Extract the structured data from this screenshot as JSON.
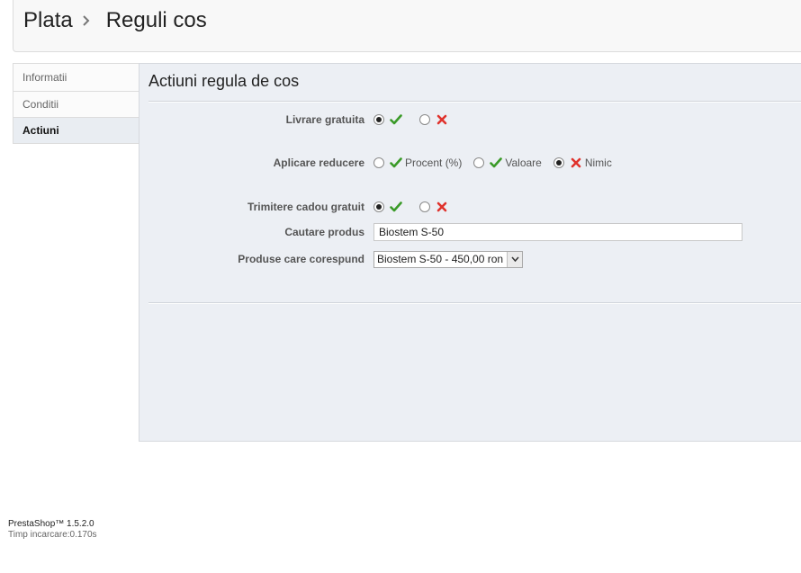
{
  "breadcrumb": {
    "parent": "Plata",
    "current": "Reguli cos"
  },
  "tabs": [
    {
      "label": "Informatii"
    },
    {
      "label": "Conditii"
    },
    {
      "label": "Actiuni"
    }
  ],
  "panel": {
    "title": "Actiuni regula de cos",
    "free_shipping": {
      "label": "Livrare gratuita",
      "value": "yes"
    },
    "discount": {
      "label": "Aplicare reducere",
      "options": [
        {
          "label": "Procent (%)",
          "icon": "check-icon"
        },
        {
          "label": "Valoare",
          "icon": "check-icon"
        },
        {
          "label": "Nimic",
          "icon": "cross-icon"
        }
      ],
      "selected": "Nimic"
    },
    "free_gift": {
      "label": "Trimitere cadou gratuit",
      "value": "yes"
    },
    "search_product": {
      "label": "Cautare produs",
      "value": "Biostem S-50"
    },
    "matching_products": {
      "label": "Produse care corespund",
      "selected": "Biostem S-50 - 450,00 ron"
    }
  },
  "footer": {
    "version": "PrestaShop™ 1.5.2.0",
    "load_time": "Timp incarcare:0.170s"
  },
  "colors": {
    "check": "#3a9a28",
    "cross": "#e0322c",
    "panel_bg": "#eceff4"
  }
}
